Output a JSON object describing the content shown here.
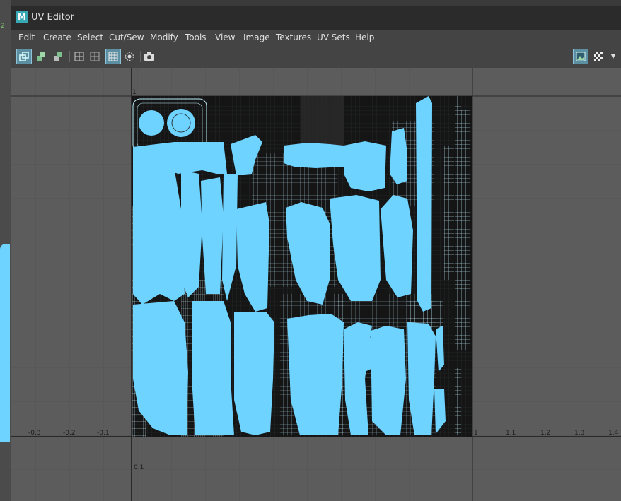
{
  "window": {
    "title": "UV Editor",
    "app_icon": "M"
  },
  "left_strip": {
    "label": "2"
  },
  "menu": [
    "Edit",
    "Create",
    "Select",
    "Cut/Sew",
    "Modify",
    "Tools",
    "View",
    "Image",
    "Textures",
    "UV Sets",
    "Help"
  ],
  "toolbar": {
    "icons": [
      "uv-shell-icon",
      "uv-vertex-icon",
      "uv-face-icon",
      "grid-icon",
      "grid-alt-icon",
      "grid-snap-icon",
      "circle-pivot-icon",
      "camera-snapshot-icon"
    ],
    "right_icons": [
      "image-display-icon",
      "checker-icon",
      "dropdown-arrow-icon"
    ]
  },
  "axis": {
    "x_ticks_neg": [
      "-0.3",
      "-0.2",
      "-0.1"
    ],
    "x_ticks_pos": [
      "1",
      "1.1",
      "1.2",
      "1.3",
      "1.4"
    ],
    "y_ticks": [
      "1",
      "0.1"
    ]
  },
  "colors": {
    "uv_fill": "#6fd3ff",
    "uv_wire": "#bff0ff",
    "texture_bg": "#151515",
    "grid_bg": "#5c5c5c"
  }
}
